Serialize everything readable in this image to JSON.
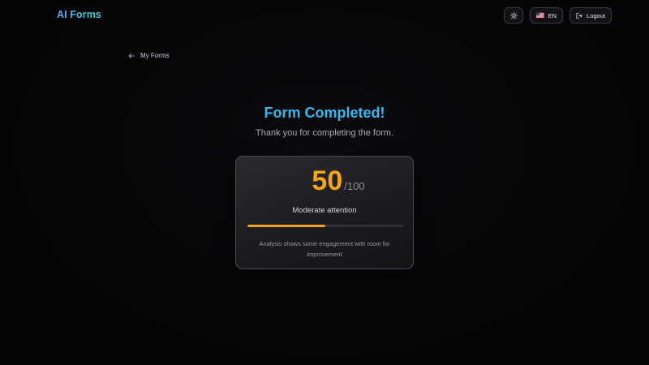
{
  "app": {
    "name": "AI Forms",
    "brand_colors": [
      "#5aa8ff",
      "#3fd6c8"
    ]
  },
  "header": {
    "theme_toggle_icon": "sun-icon",
    "language": {
      "flag": "us-flag-icon",
      "code": "EN"
    },
    "logout_label": "Logout",
    "logout_icon": "logout-icon"
  },
  "nav": {
    "back_label": "My Forms",
    "back_icon": "arrow-left-icon"
  },
  "result": {
    "title": "Form Completed!",
    "subtitle": "Thank you for completing the form.",
    "score": "50",
    "score_max": "/100",
    "score_fraction": 0.5,
    "level": "Moderate attention",
    "analysis": "Analysis shows some engagement with room for improvement",
    "accent_color": "#f2a516",
    "title_color": "#3bb6ea"
  }
}
